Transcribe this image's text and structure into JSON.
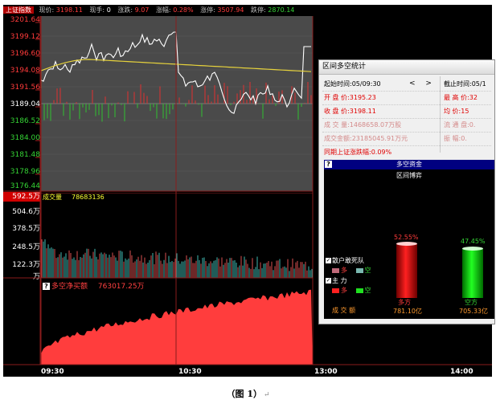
{
  "header": {
    "index_name": "上证指数",
    "now_label": "现价:",
    "now_value": "3198.11",
    "hand_label": "现手:",
    "hand_value": "0",
    "chg_label": "涨跌:",
    "chg_value": "9.07",
    "pct_label": "涨幅:",
    "pct_value": "0.28%",
    "high_label": "涨停:",
    "high_value": "3507.94",
    "low_label": "跌停:",
    "low_value": "2870.14"
  },
  "price_axis": [
    {
      "text": "3201.64",
      "color": "#ff3b3b"
    },
    {
      "text": "3199.12",
      "color": "#ff3b3b"
    },
    {
      "text": "3196.60",
      "color": "#ff3b3b"
    },
    {
      "text": "3194.08",
      "color": "#ff3b3b"
    },
    {
      "text": "3191.56",
      "color": "#ff3b3b"
    },
    {
      "text": "3189.04",
      "color": "#ffffff"
    },
    {
      "text": "3186.52",
      "color": "#35d435"
    },
    {
      "text": "3184.00",
      "color": "#35d435"
    },
    {
      "text": "3181.48",
      "color": "#35d435"
    },
    {
      "text": "3178.96",
      "color": "#35d435"
    },
    {
      "text": "3176.44",
      "color": "#35d435"
    }
  ],
  "volume": {
    "label": "成交量",
    "value": "78683136",
    "max_label": "592.5万",
    "axis": [
      "504.6万",
      "378.5万",
      "248.5万",
      "122.3万",
      "万"
    ]
  },
  "fund_flow": {
    "icon_label": "?",
    "label": "多空净买额",
    "value": "763017.25万"
  },
  "time_axis": [
    "09:30",
    "10:30",
    "13:00",
    "14:00"
  ],
  "popup": {
    "title": "区间多空统计",
    "start_label": "起始时间:",
    "start_value": "05/09:30",
    "end_label": "截止时间:",
    "end_value": "05/1",
    "range_arrows": "< >",
    "open_label": "开 盘 价:",
    "open_value": "3195.23",
    "high_label": "最 高 价:",
    "high_value": "32",
    "close_label": "收 盘 价:",
    "close_value": "3198.11",
    "avg_label": "均   价:",
    "avg_value": "15",
    "vol_label": "成 交 量:",
    "vol_value": "1468658.07万股",
    "float_label": "流 通 盘:",
    "float_value": "0.",
    "amount_label": "成交金额:",
    "amount_value": "23185045.91万元",
    "swing_label": "振   幅:",
    "swing_value": "0.",
    "period_pct": "同期上证涨跌幅:0.09%",
    "fund_panel": {
      "help": "?",
      "title": "多空资金",
      "subtitle": "区间博弈",
      "retail_label": "散户敢死队",
      "retail_long": "多",
      "retail_short": "空",
      "main_label": "主      力",
      "main_long": "多",
      "main_short": "空",
      "amount_label": "成  交  额",
      "long_pct": "52.55%",
      "long_name": "多方",
      "long_amount": "781.10亿",
      "short_pct": "47.45%",
      "short_name": "空方",
      "short_amount": "705.33亿"
    }
  },
  "caption": "（图 1）",
  "caption_mark": "↵",
  "colors": {
    "up": "#ff3b3b",
    "down": "#35d435",
    "avg_line": "#e6d23c",
    "fund_fill": "#ff3d3d",
    "grid": "#8a1c1c"
  }
}
